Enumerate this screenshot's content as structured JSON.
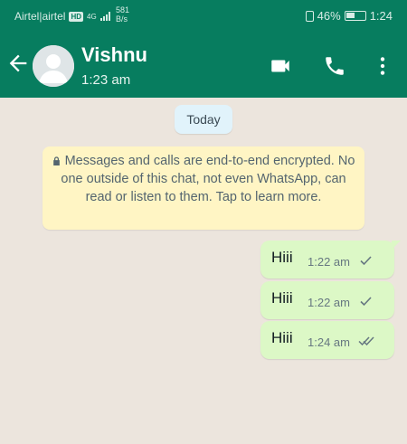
{
  "status_bar": {
    "carrier": "Airtel|airtel",
    "hd_badge": "HD",
    "network": "4G",
    "speed_value": "581",
    "speed_unit": "B/s",
    "battery": "46%",
    "time": "1:24"
  },
  "header": {
    "contact_name": "Vishnu",
    "last_seen": "1:23 am",
    "icons": [
      "back-arrow-icon",
      "avatar",
      "video-call-icon",
      "voice-call-icon",
      "more-options-icon"
    ]
  },
  "chat": {
    "day_label": "Today",
    "encryption_notice": "Messages and calls are end-to-end encrypted. No one outside of this chat, not even WhatsApp, can read or listen to them. Tap to learn more.",
    "messages": [
      {
        "text": "Hiii",
        "time": "1:22 am",
        "status": "sent"
      },
      {
        "text": "Hiii",
        "time": "1:22 am",
        "status": "sent"
      },
      {
        "text": "Hiii",
        "time": "1:24 am",
        "status": "delivered"
      }
    ]
  },
  "colors": {
    "header": "#077d5f",
    "chat_background": "#ece5dd",
    "outgoing_bubble": "#dcf8c6",
    "notice_background": "#fff5c4"
  }
}
